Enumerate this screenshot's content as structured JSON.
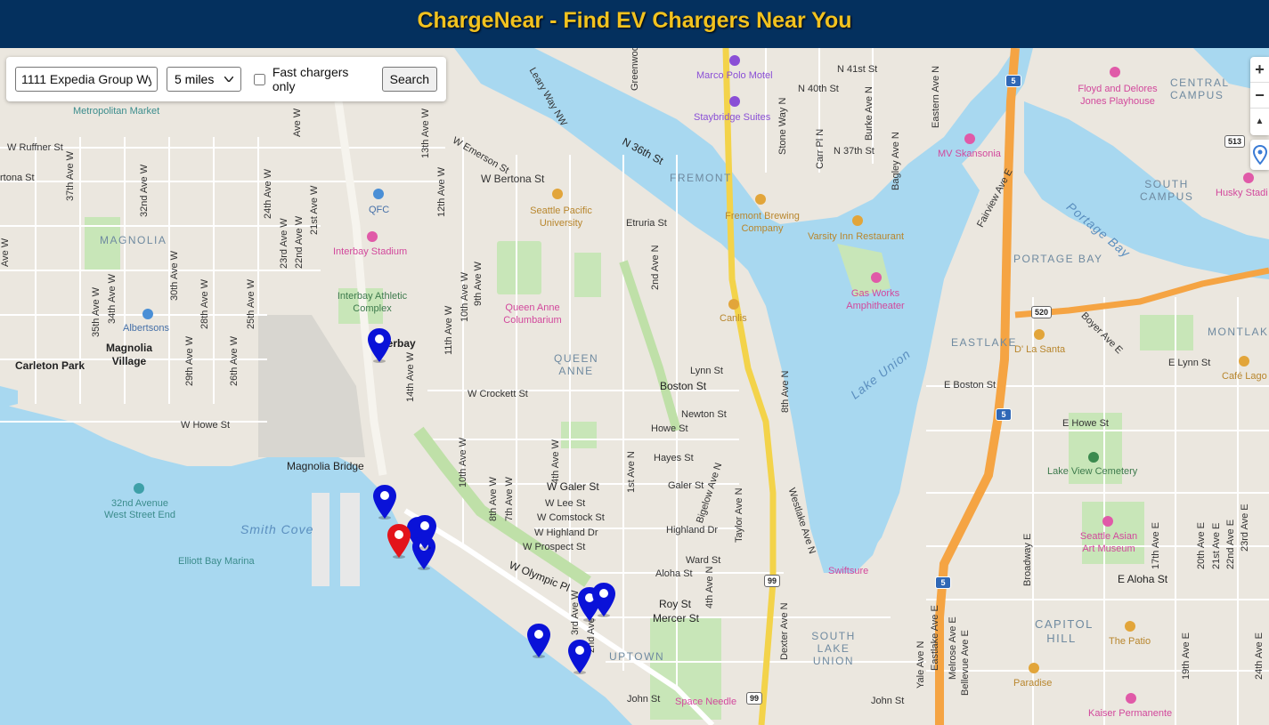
{
  "header": {
    "title": "ChargeNear - Find EV Chargers Near You"
  },
  "search": {
    "address_value": "1111 Expedia Group Wy",
    "radius_selected": "5 miles",
    "fast_label": "Fast chargers only",
    "fast_checked": false,
    "button_label": "Search"
  },
  "controls": {
    "zoom_in": "+",
    "zoom_out": "−",
    "reset_north": "▲"
  },
  "map": {
    "streets": {
      "w_ruffner": "W Ruffner St",
      "w_bertona_left": "rtona St",
      "w_bertona": "W Bertona St",
      "w_emerson": "W Emerson St",
      "w_crockett": "W Crockett St",
      "w_howe": "W Howe St",
      "magnolia_bridge": "Magnolia Bridge",
      "w_galer": "W Galer St",
      "galer": "Galer St",
      "w_lee": "W Lee St",
      "w_comstock": "W Comstock St",
      "w_highland": "W Highland Dr",
      "w_prospect": "W Prospect St",
      "w_olympic": "W Olympic Pl",
      "highland": "Highland Dr",
      "ward": "Ward St",
      "aloha": "Aloha St",
      "roy": "Roy St",
      "mercer": "Mercer St",
      "john_left": "John St",
      "john_right": "John St",
      "lynn": "Lynn St",
      "boston": "Boston St",
      "newton": "Newton St",
      "howe": "Howe St",
      "hayes": "Hayes St",
      "etruria": "Etruria St",
      "n36": "N 36th St",
      "n37": "N 37th St",
      "n40": "N 40th St",
      "n41": "N 41st St",
      "e_boston": "E Boston St",
      "e_howe": "E Howe St",
      "e_aloha": "E Aloha St",
      "e_lynn": "E Lynn St",
      "leary": "Leary Way NW",
      "stone": "Stone Way N",
      "carr": "Carr Pl N",
      "burke": "Burke Ave N",
      "bagley": "Bagley Ave N",
      "eastern": "Eastern Ave N",
      "fairview": "Fairview Ave E",
      "boyer": "Boyer Ave E",
      "greenwood": "Greenwood",
      "ave37": "37th Ave W",
      "ave32": "32nd Ave W",
      "ave24": "24th Ave W",
      "ave21": "21st Ave W",
      "ave22": "22nd Ave W",
      "ave23": "23rd Ave W",
      "ave35": "35th Ave W",
      "ave34": "34th Ave W",
      "ave30": "30th Ave W",
      "ave28": "28th Ave W",
      "ave25": "25th Ave W",
      "ave29": "29th Ave W",
      "ave26": "26th Ave W",
      "ave13": "13th Ave W",
      "ave12": "12th Ave W",
      "ave14": "14th Ave W",
      "ave11": "11th Ave W",
      "ave10": "10th Ave W",
      "ave10b": "10th Ave W",
      "ave9": "9th Ave W",
      "ave2n": "2nd Ave N",
      "ave8n": "8th Ave N",
      "ave4w": "4th Ave W",
      "ave1n": "1st Ave N",
      "bigelow": "Bigelow Ave N",
      "taylor": "Taylor Ave N",
      "westlake": "Westlake Ave N",
      "ave8w": "8th Ave W",
      "ave7w": "7th Ave W",
      "ave3w": "3rd Ave W",
      "ave2w": "2nd Ave W",
      "ave4n": "4th Ave N",
      "dexter": "Dexter Ave N",
      "broadway": "Broadway E",
      "yale": "Yale Ave N",
      "eastlake": "Eastlake Ave E",
      "melrose": "Melrose Ave E",
      "bellevue": "Bellevue Ave E",
      "ave17": "17th Ave E",
      "ave19": "19th Ave E",
      "ave20": "20th Ave E",
      "ave21e": "21st Ave E",
      "ave22e": "22nd Ave E",
      "ave23e": "23rd Ave E",
      "ave24e": "24th Ave E",
      "ave_e": "E",
      "ave_left1": "Ave W",
      "ave_left2": "Ave W"
    },
    "areas": {
      "magnolia": "MAGNOLIA",
      "queen_anne": "QUEEN ANNE",
      "fremont": "FREMONT",
      "portage_bay": "PORTAGE BAY",
      "eastlake": "EASTLAKE",
      "central_campus": "CENTRAL CAMPUS",
      "south_campus": "SOUTH CAMPUS",
      "montlake": "MONTLAKE",
      "uptown": "UPTOWN",
      "south_lake_union": "SOUTH LAKE UNION",
      "capitol_hill": "CAPITOL HILL"
    },
    "places": {
      "metropolitan_market": "Metropolitan Market",
      "marco_polo": "Marco Polo Motel",
      "staybridge": "Staybridge Suites",
      "floyd": "Floyd and Delores Jones Playhouse",
      "mv_skansonia": "MV Skansonia",
      "husky": "Husky Stadi",
      "qfc": "QFC",
      "spu": "Seattle Pacific University",
      "fremont_brewing": "Fremont Brewing Company",
      "varsity": "Varsity Inn Restaurant",
      "interbay_stadium": "Interbay Stadium",
      "interbay_athletic": "Interbay Athletic Complex",
      "albertsons": "Albertsons",
      "magnolia_village": "Magnolia Village",
      "carleton_park": "Carleton Park",
      "interbay": "Interbay",
      "queen_anne_columbarium": "Queen Anne Columbarium",
      "canlis": "Canlis",
      "gas_works": "Gas Works Amphitheater",
      "d_la_santa": "D' La Santa",
      "cafe_lago": "Café Lago",
      "lake_view": "Lake View Cemetery",
      "ave32_stop": "32nd Avenue West Street End",
      "elliott_marina": "Elliott Bay Marina",
      "swiftsure": "Swiftsure",
      "seattle_asian": "Seattle Asian Art Museum",
      "the_patio": "The Patio",
      "paradise": "Paradise",
      "space_needle": "Space Needle",
      "kaiser": "Kaiser Permanente"
    },
    "water": {
      "portage_bay": "Portage Bay",
      "lake_union": "Lake Union",
      "smith_cove": "Smith Cove"
    },
    "shields": {
      "i5a": "5",
      "i5b": "5",
      "i5c": "5",
      "sr520": "520",
      "sr513": "513",
      "sr99a": "99",
      "sr99b": "99"
    },
    "markers": {
      "user_color": "#e3141b",
      "charger_color": "#0a12d8",
      "charger_count": 10
    }
  }
}
